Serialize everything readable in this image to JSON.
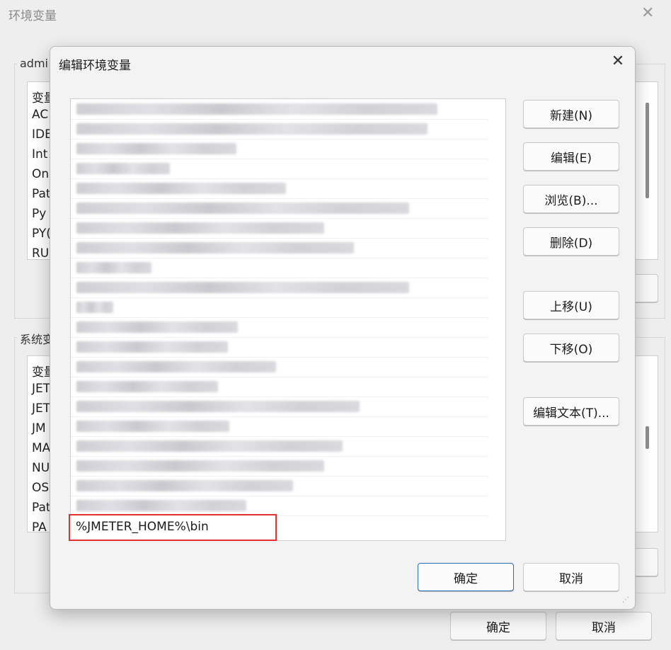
{
  "parent_window": {
    "title": "环境变量",
    "close_glyph": "✕",
    "user_group_label": "admi",
    "user_vars": {
      "header": "变量",
      "rows": [
        "AC",
        "IDE",
        "Int",
        "On",
        "Pat",
        "Py",
        "PY(",
        "RU"
      ]
    },
    "system_group_label": "系统变",
    "system_vars": {
      "header": "变量",
      "rows": [
        "JET",
        "JET",
        "JM",
        "MA",
        "NU",
        "OS",
        "Pat",
        "PA"
      ]
    },
    "ok_label": "确定",
    "cancel_label": "取消"
  },
  "dialog": {
    "title": "编辑环境变量",
    "close_glyph": "✕",
    "editing_value": "%JMETER_HOME%\\bin",
    "buttons": {
      "new": "新建(N)",
      "edit": "编辑(E)",
      "browse": "浏览(B)...",
      "delete": "删除(D)",
      "move_up": "上移(U)",
      "move_down": "下移(O)",
      "edit_text": "编辑文本(T)...",
      "ok": "确定",
      "cancel": "取消"
    },
    "path_entries_redacted": 21,
    "highlight_color": "#e0312d"
  }
}
